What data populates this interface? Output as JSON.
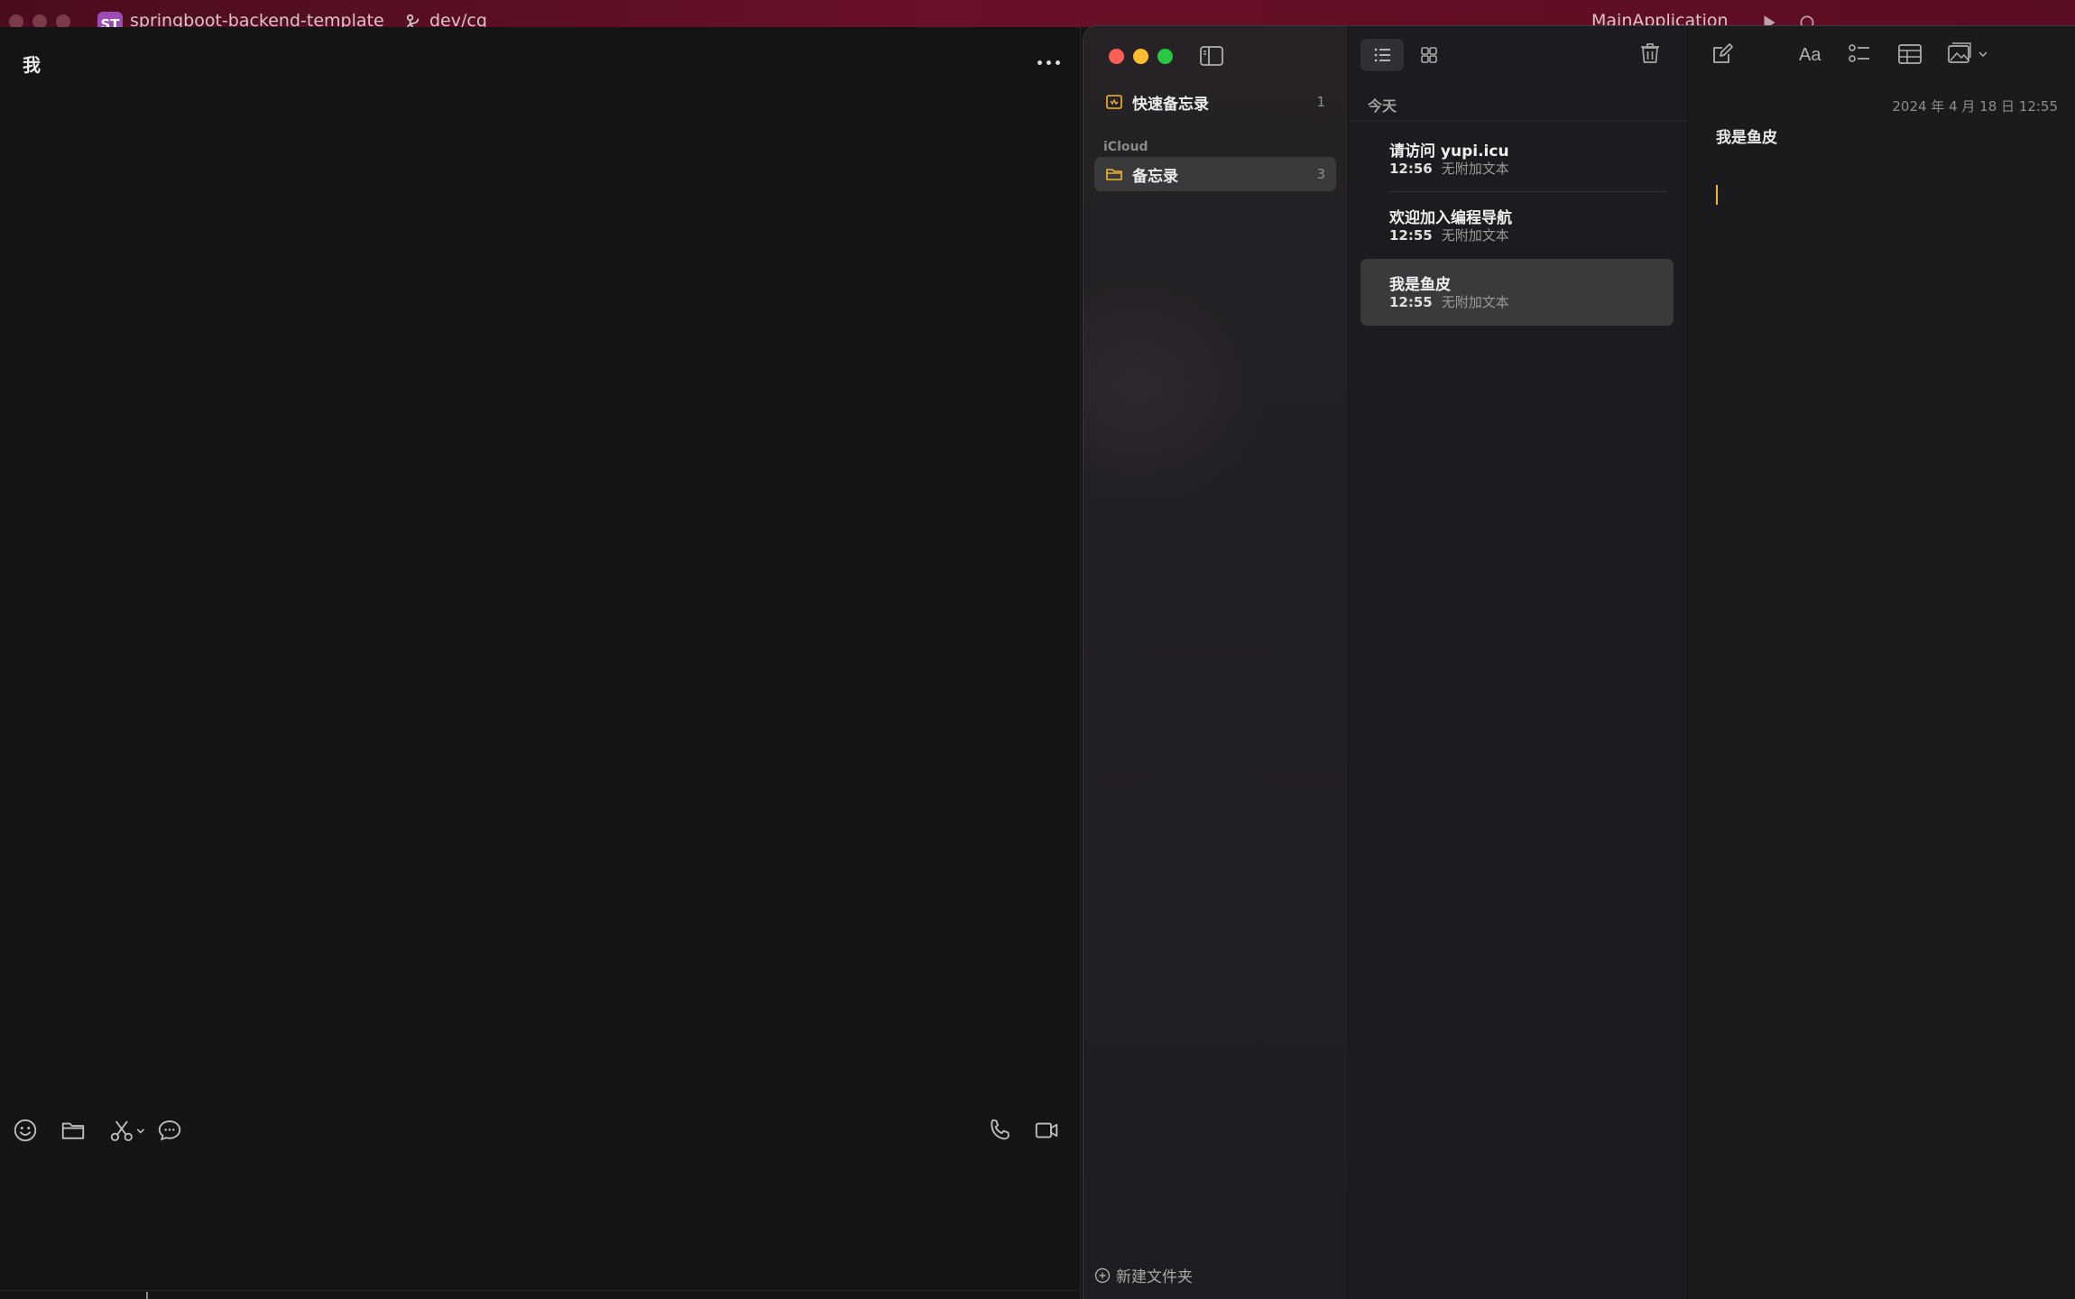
{
  "ide": {
    "badge": "ST",
    "project": "springboot-backend-template",
    "branch": "dev/cq",
    "run_config": "MainApplication"
  },
  "chat": {
    "title": "我"
  },
  "notes": {
    "sidebar": {
      "quick_notes": {
        "label": "快速备忘录",
        "count": "1"
      },
      "section_label": "iCloud",
      "folder": {
        "label": "备忘录",
        "count": "3"
      },
      "new_folder_label": "新建文件夹"
    },
    "list": {
      "group_header": "今天",
      "items": [
        {
          "title": "请访问 yupi.icu",
          "time": "12:56",
          "preview": "无附加文本"
        },
        {
          "title": "欢迎加入编程导航",
          "time": "12:55",
          "preview": "无附加文本"
        },
        {
          "title": "我是鱼皮",
          "time": "12:55",
          "preview": "无附加文本"
        }
      ]
    },
    "editor": {
      "date": "2024 年 4 月 18 日 12:55",
      "title": "我是鱼皮",
      "format_label": "Aa"
    }
  },
  "colors": {
    "ide_bar": "#6a1028",
    "accent_folder": "#f5b731",
    "cursor": "#f2b53a",
    "traffic_red": "#ff5f57",
    "traffic_yellow": "#febc2e",
    "traffic_green": "#28c840"
  },
  "icons": {
    "chat_toolbar": [
      "emoji-icon",
      "folder-icon",
      "scissors-icon",
      "chat-bubble-icon",
      "phone-icon",
      "video-camera-icon"
    ],
    "notes_toolbar": [
      "sidebar-toggle-icon",
      "list-view-icon",
      "gallery-view-icon",
      "trash-icon",
      "compose-icon",
      "format-text-icon",
      "checklist-icon",
      "table-icon",
      "media-icon"
    ]
  }
}
